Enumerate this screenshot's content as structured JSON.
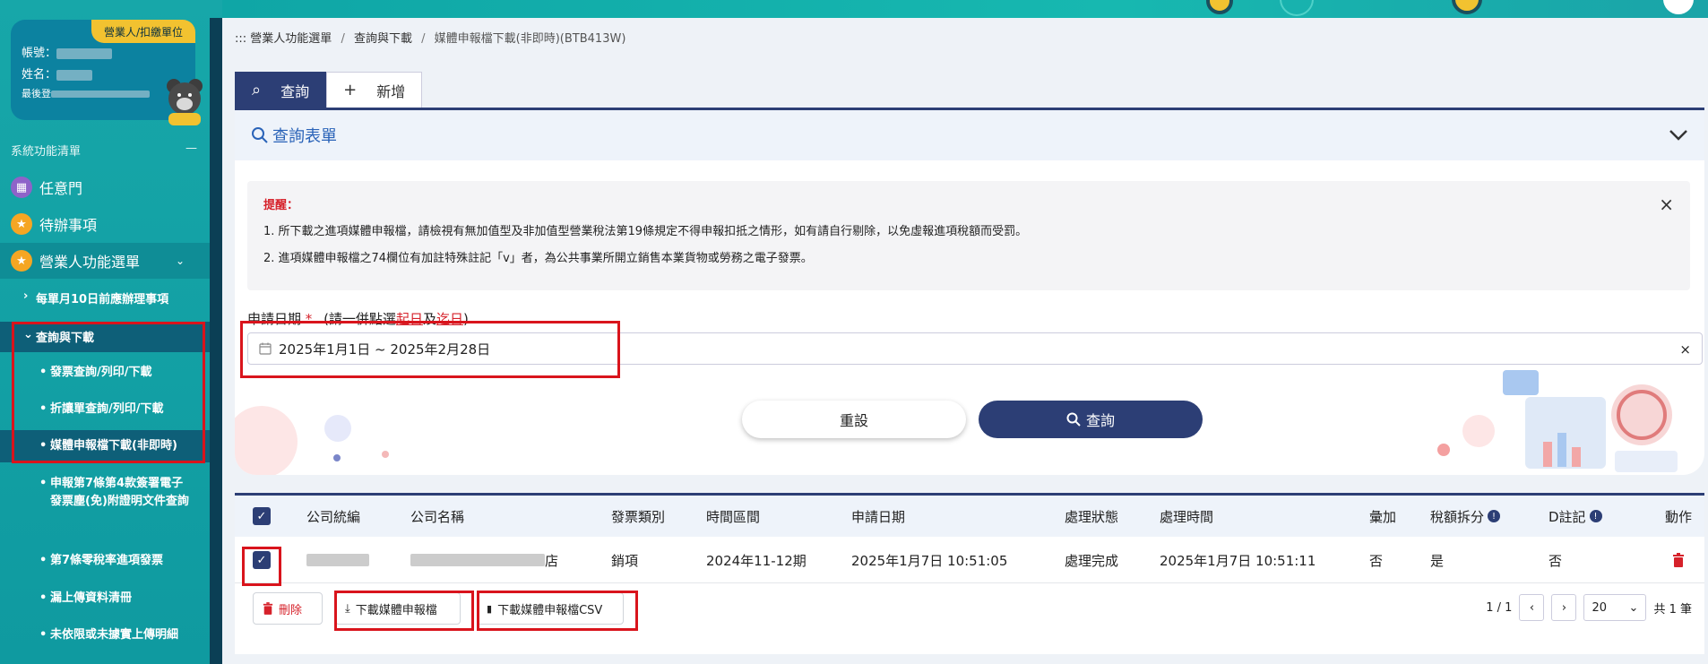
{
  "user": {
    "role_badge": "營業人/扣繳單位",
    "account_label": "帳號：",
    "name_label": "姓名：",
    "last_login_label": "最後登"
  },
  "sidebar": {
    "menu_title": "系統功能清單",
    "collapse_symbol": "—",
    "items": [
      {
        "label": "任意門",
        "icon": "map-icon"
      },
      {
        "label": "待辦事項",
        "icon": "star-icon"
      },
      {
        "label": "營業人功能選單",
        "icon": "star-icon"
      }
    ],
    "sub_items": [
      {
        "label": "每單月10日前應辦理事項"
      },
      {
        "label": "查詢與下載"
      }
    ],
    "subsub_items": [
      {
        "label": "發票查詢/列印/下載"
      },
      {
        "label": "折讓單查詢/列印/下載"
      },
      {
        "label": "媒體申報檔下載(非即時)"
      },
      {
        "label": "申報第7條第4款簽署電子發票塵(免)附證明文件查詢"
      },
      {
        "label": "第7條零稅率進項發票"
      },
      {
        "label": "漏上傳資料清冊"
      },
      {
        "label": "未依限或未據實上傳明細"
      }
    ]
  },
  "breadcrumb": {
    "prefix": ":::",
    "items": [
      "營業人功能選單",
      "查詢與下載",
      "媒體申報檔下載(非即時)(BTB413W)"
    ],
    "separator": "/"
  },
  "tabs": [
    {
      "label": "查詢",
      "icon": "search-icon",
      "active": true
    },
    {
      "label": "新增",
      "icon": "plus-icon",
      "active": false
    }
  ],
  "form": {
    "title": "查詢表單",
    "alert": {
      "title": "提醒：",
      "lines": [
        "1. 所下載之進項媒體申報檔，請檢視有無加值型及非加值型營業稅法第19條規定不得申報扣抵之情形，如有請自行剔除，以免虛報進項稅額而受罰。",
        "2. 進項媒體申報檔之74欄位有加註特殊註記「v」者，為公共事業所開立銷售本業貨物或勞務之電子發票。"
      ]
    },
    "date_label": "申請日期",
    "required_mark": "*",
    "date_hint_open": "(請一併點選",
    "date_hint_start": "起日",
    "date_hint_mid": "及",
    "date_hint_end": "迄日",
    "date_hint_close": ")",
    "date_value": "2025年1月1日 ~ 2025年2月28日",
    "clear_symbol": "×",
    "reset_label": "重設",
    "query_label": "查詢"
  },
  "table": {
    "columns": [
      "公司統編",
      "公司名稱",
      "發票類別",
      "時間區間",
      "申請日期",
      "處理狀態",
      "處理時間",
      "彙加",
      "稅額拆分",
      "D註記",
      "動作"
    ],
    "rows": [
      {
        "company_name_suffix": "店",
        "invoice_type": "銷項",
        "period": "2024年11-12期",
        "apply_date": "2025年1月7日 10:51:05",
        "status": "處理完成",
        "process_time": "2025年1月7日 10:51:11",
        "aggregate": "否",
        "tax_split": "是",
        "d_note": "否"
      }
    ],
    "delete_label": "刪除",
    "download_label": "下載媒體申報檔",
    "download_csv_label": "下載媒體申報檔CSV",
    "page_info": "1 / 1",
    "page_size": "20",
    "total": "共 1 筆"
  }
}
